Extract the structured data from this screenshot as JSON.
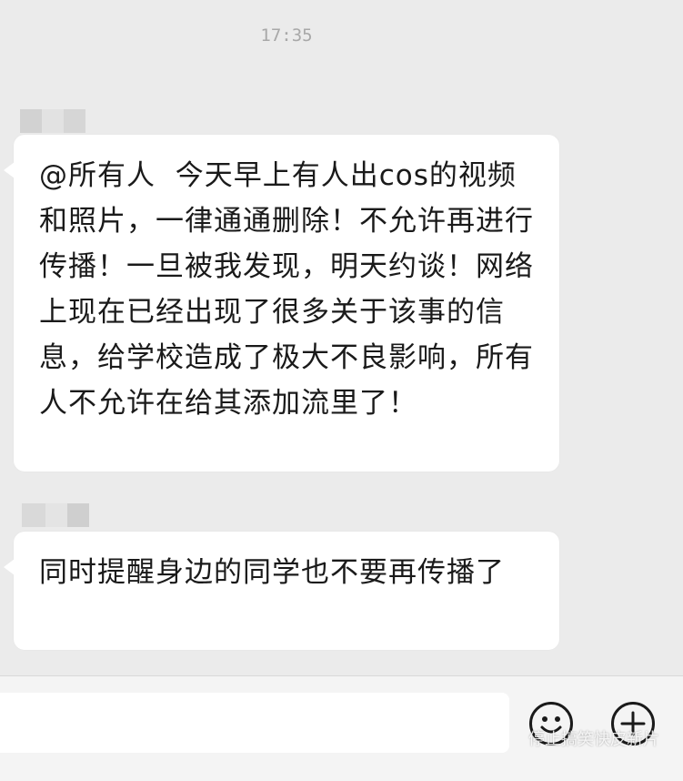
{
  "conversation": {
    "timestamp": "17:35",
    "messages": [
      {
        "text": "@所有人  今天早上有人出cos的视频和照片，一律通通删除！不允许再进行传播！一旦被我发现，明天约谈！网络上现在已经出现了很多关于该事的信息，给学校造成了极大不良影响，所有人不允许在给其添加流里了！"
      },
      {
        "text": "同时提醒身边的同学也不要再传播了"
      }
    ]
  },
  "input_bar": {
    "emoji_icon": "smiley-face-icon",
    "plus_icon": "plus-circle-icon"
  },
  "watermark": "停止搞笑快皮新片",
  "colors": {
    "background": "#ebebeb",
    "bubble": "#ffffff",
    "text": "#1a1a1a",
    "timestamp": "#a8a8a8"
  }
}
